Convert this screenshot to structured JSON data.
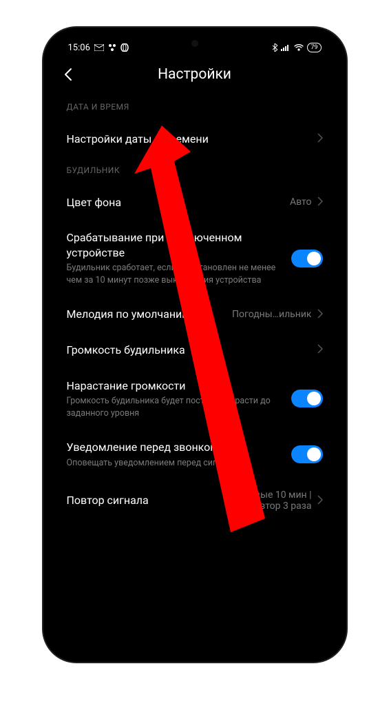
{
  "status_bar": {
    "time": "15:06",
    "battery": "79"
  },
  "header": {
    "title": "Настройки"
  },
  "sections": {
    "date_time": {
      "header": "ДАТА И ВРЕМЯ",
      "settings_item": "Настройки даты и времени"
    },
    "alarm": {
      "header": "БУДИЛЬНИК",
      "bg_color": {
        "label": "Цвет фона",
        "value": "Авто"
      },
      "trigger_off": {
        "label": "Срабатывание при выключенном устройстве",
        "subtitle": "Будильник сработает, если он установлен не менее чем за 10 минут позже выключения устройства"
      },
      "default_melody": {
        "label": "Мелодия по умолчанию",
        "value": "Погодны…ильник"
      },
      "alarm_volume": {
        "label": "Громкость будильника"
      },
      "volume_increase": {
        "label": "Нарастание громкости",
        "subtitle": "Громкость будильника будет постепенно расти до заданного уровня"
      },
      "notify_before": {
        "label": "Уведомление перед звонком",
        "subtitle": "Оповещать уведомлением перед сигналами"
      },
      "repeat": {
        "label": "Повтор сигнала",
        "value": "Каждые 10 мин | Повтор 3 раза"
      }
    }
  },
  "colors": {
    "accent": "#0a84ff",
    "annotation": "#ff0000"
  }
}
